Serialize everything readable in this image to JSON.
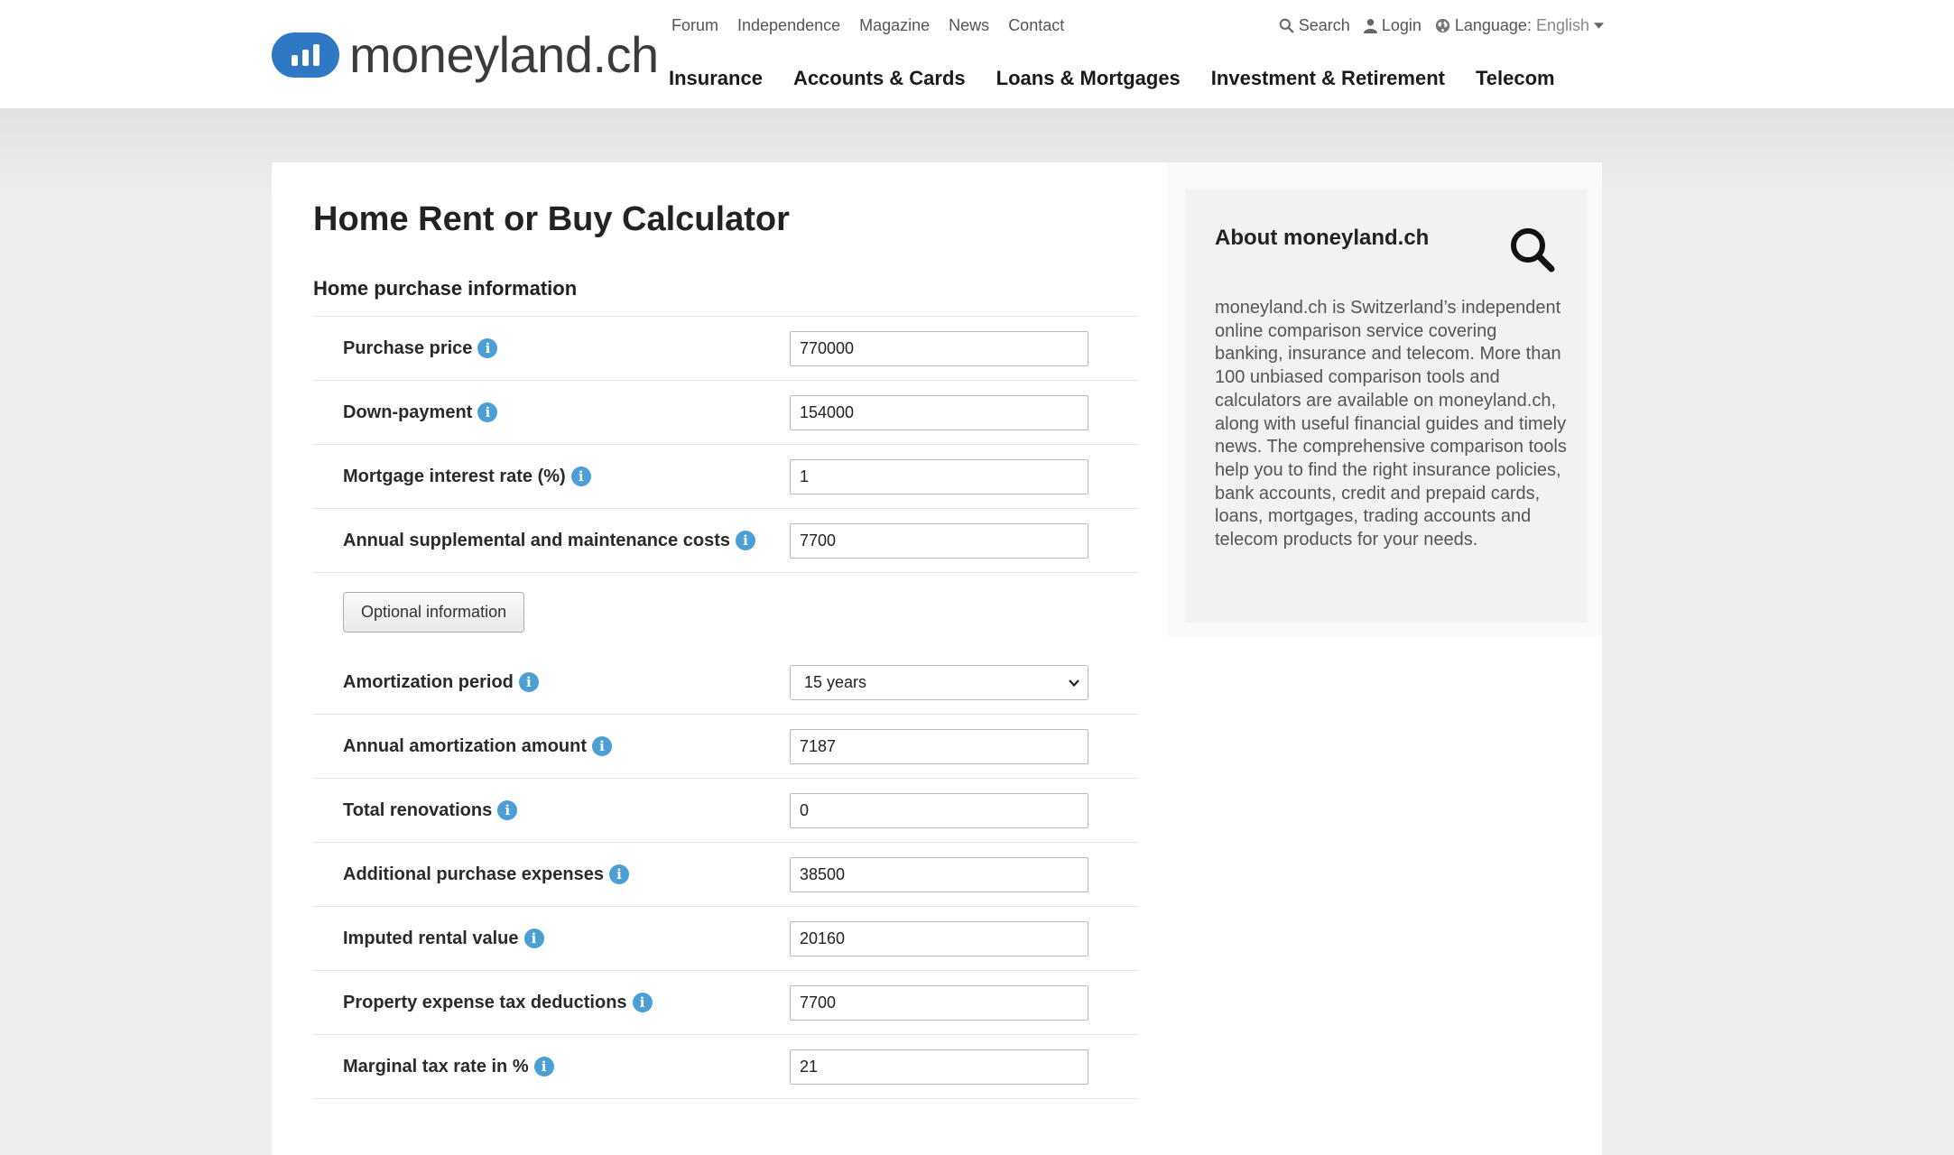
{
  "header": {
    "logo_text": "moneyland.ch",
    "top_nav": [
      "Forum",
      "Independence",
      "Magazine",
      "News",
      "Contact"
    ],
    "search_label": "Search",
    "login_label": "Login",
    "language_label": "Language:",
    "language_value": "English",
    "main_nav": [
      "Insurance",
      "Accounts & Cards",
      "Loans & Mortgages",
      "Investment & Retirement",
      "Telecom"
    ]
  },
  "main": {
    "title": "Home Rent or Buy Calculator",
    "section_title": "Home purchase information",
    "fields": [
      {
        "label": "Purchase price",
        "value": "770000"
      },
      {
        "label": "Down-payment",
        "value": "154000"
      },
      {
        "label": "Mortgage interest rate (%)",
        "value": "1"
      },
      {
        "label": "Annual supplemental and maintenance costs",
        "value": "7700"
      }
    ],
    "optional_button": "Optional information",
    "amortization": {
      "label": "Amortization period",
      "selected": "15 years"
    },
    "optional_fields": [
      {
        "label": "Annual amortization amount",
        "value": "7187"
      },
      {
        "label": "Total renovations",
        "value": "0"
      },
      {
        "label": "Additional purchase expenses",
        "value": "38500"
      },
      {
        "label": "Imputed rental value",
        "value": "20160"
      },
      {
        "label": "Property expense tax deductions",
        "value": "7700"
      },
      {
        "label": "Marginal tax rate in %",
        "value": "21"
      }
    ]
  },
  "sidebar": {
    "about_title": "About moneyland.ch",
    "about_text": "moneyland.ch is Switzerland’s independent online comparison service covering banking, insurance and telecom. More than 100 unbiased comparison tools and calculators are available on moneyland.ch, along with useful financial guides and timely news. The comprehensive comparison tools help you to find the right insurance policies, bank accounts, credit and prepaid cards, loans, mortgages, trading accounts and telecom products for your needs."
  },
  "colors": {
    "brand_blue": "#2f78c4",
    "info_icon": "#4b9fd5",
    "page_background": "#eeeeee"
  }
}
